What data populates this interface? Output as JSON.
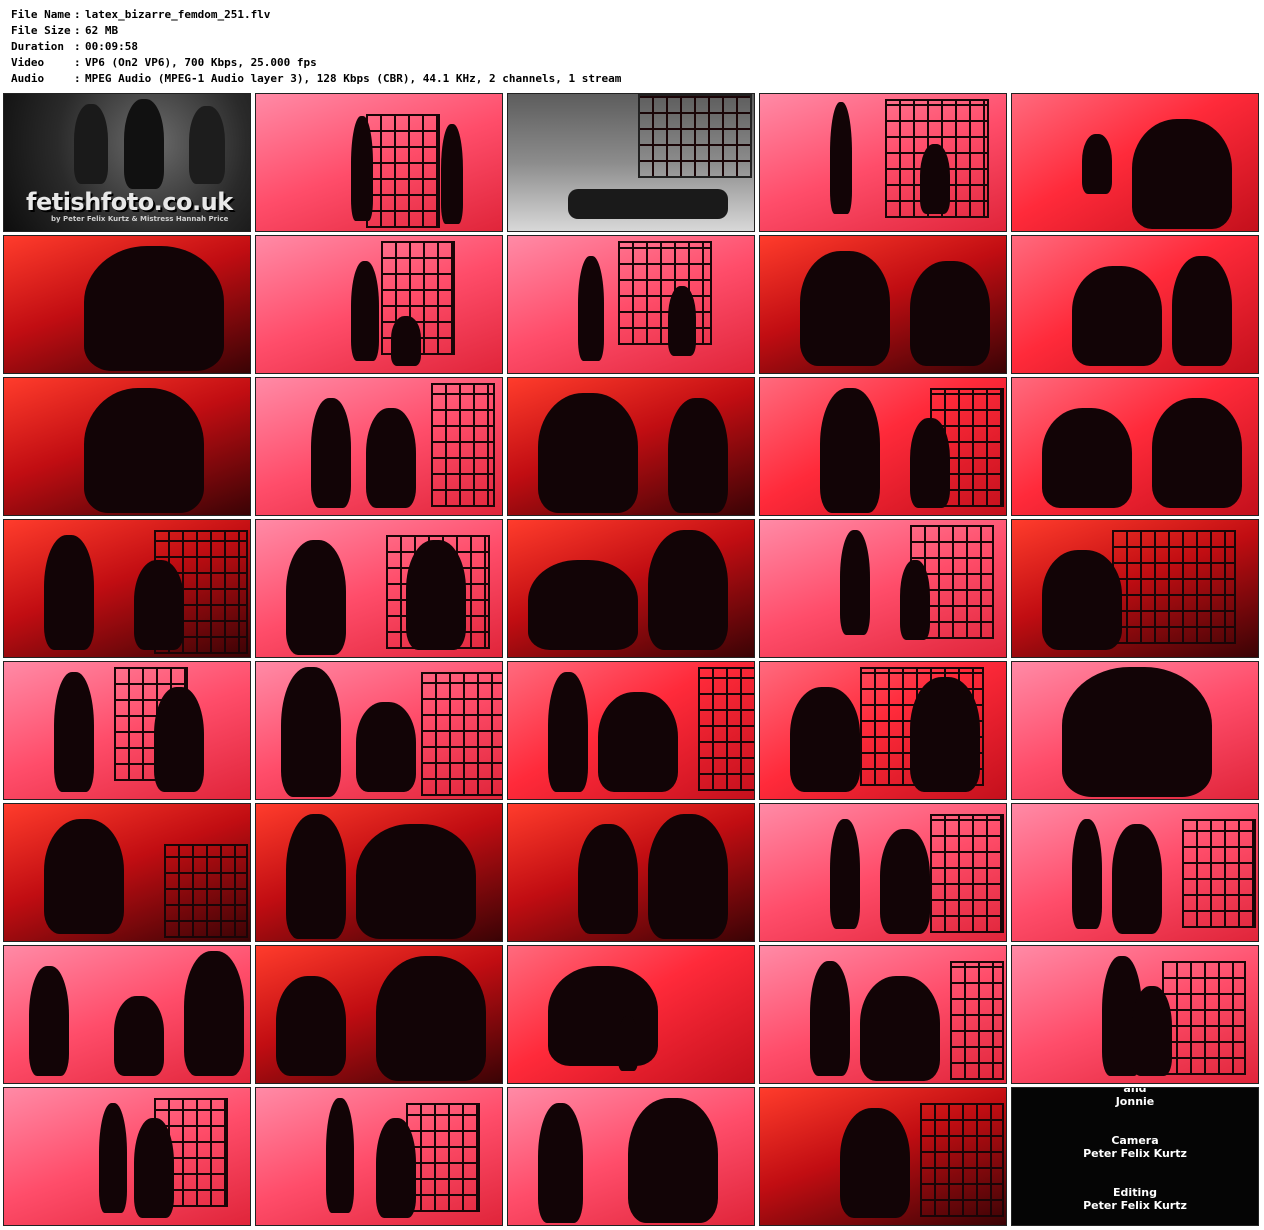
{
  "meta": [
    {
      "key": "File Name",
      "value": "latex_bizarre_femdom_251.flv"
    },
    {
      "key": "File Size",
      "value": "62 MB"
    },
    {
      "key": "Duration",
      "value": "00:09:58"
    },
    {
      "key": "Video",
      "value": "VP6 (On2 VP6), 700 Kbps, 25.000 fps"
    },
    {
      "key": "Audio",
      "value": "MPEG Audio (MPEG-1 Audio layer 3), 128 Kbps (CBR), 44.1 KHz, 2 channels, 1 stream"
    }
  ],
  "separator": ":",
  "logo": {
    "title": "fetishfoto.co.uk",
    "subtitle": "by Peter Felix Kurtz & Mistress Hannah Price"
  },
  "credits": {
    "line1": "and",
    "line2": "Jonnie",
    "camera_label": "Camera",
    "camera_name": "Peter Felix Kurtz",
    "editing_label": "Editing",
    "editing_name": "Peter Felix Kurtz"
  },
  "colors": {
    "background": "#ffffff",
    "scene_red": "#ff2a3a",
    "scene_pink": "#ff4d6a",
    "figure": "#120406"
  }
}
